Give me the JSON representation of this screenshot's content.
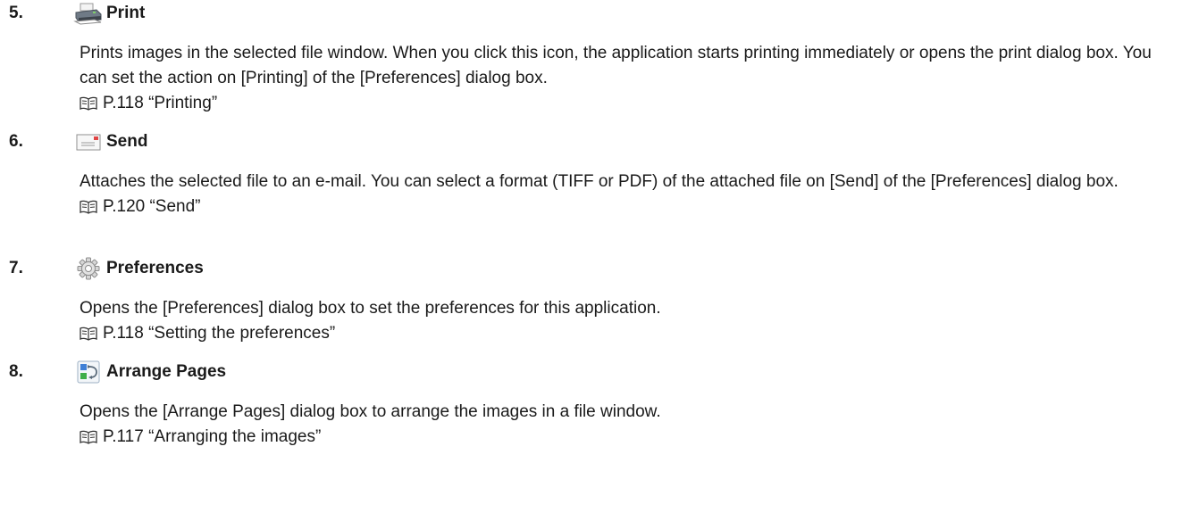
{
  "items": [
    {
      "number": "5.",
      "title": "Print",
      "icon": "printer-icon",
      "description": "Prints images in the selected file window. When you click this icon, the application starts printing immediately or opens the print dialog box. You can set the action on [Printing] of the [Preferences] dialog box.",
      "reference": "P.118 “Printing”"
    },
    {
      "number": "6.",
      "title": "Send",
      "icon": "envelope-icon",
      "description": "Attaches the selected file to an e-mail. You can select a format (TIFF or PDF) of the attached file on [Send] of the [Preferences] dialog box.",
      "reference": "P.120 “Send”"
    },
    {
      "number": "7.",
      "title": "Preferences",
      "icon": "gear-icon",
      "description": "Opens the [Preferences] dialog box to set the preferences for this application.",
      "reference": "P.118 “Setting the preferences”"
    },
    {
      "number": "8.",
      "title": "Arrange Pages",
      "icon": "arrange-pages-icon",
      "description": "Opens the [Arrange Pages] dialog box to arrange the images in a file window.",
      "reference": "P.117 “Arranging the images”"
    }
  ]
}
